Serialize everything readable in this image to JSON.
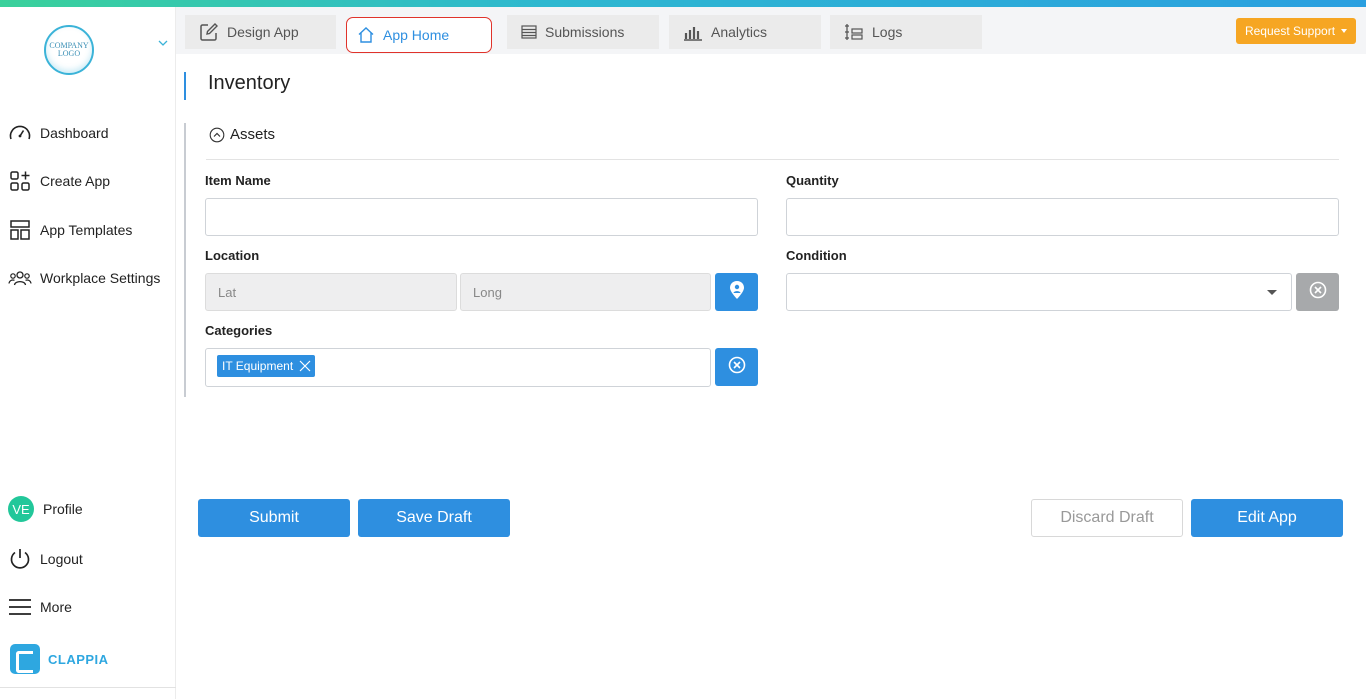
{
  "app": {
    "logo_text": "COMPANY LOGO"
  },
  "sidebar": {
    "items": [
      {
        "label": "Dashboard",
        "icon": "speedometer-icon"
      },
      {
        "label": "Create App",
        "icon": "grid-plus-icon"
      },
      {
        "label": "App Templates",
        "icon": "layout-template-icon"
      },
      {
        "label": "Workplace Settings",
        "icon": "users-icon"
      }
    ],
    "bottom_items": [
      {
        "label": "Profile",
        "icon": "avatar",
        "initials": "VE"
      },
      {
        "label": "Logout",
        "icon": "power-icon"
      },
      {
        "label": "More",
        "icon": "hamburger-icon"
      }
    ],
    "brand": "CLAPPIA"
  },
  "tabs": [
    {
      "label": "Design App",
      "icon": "edit-icon",
      "active": false
    },
    {
      "label": "App Home",
      "icon": "home-icon",
      "active": true
    },
    {
      "label": "Submissions",
      "icon": "list-icon",
      "active": false
    },
    {
      "label": "Analytics",
      "icon": "bar-chart-icon",
      "active": false
    },
    {
      "label": "Logs",
      "icon": "logs-icon",
      "active": false
    }
  ],
  "support_label": "Request Support",
  "page": {
    "title": "Inventory",
    "section_title": "Assets"
  },
  "form": {
    "item_name": {
      "label": "Item Name",
      "value": ""
    },
    "quantity": {
      "label": "Quantity",
      "value": ""
    },
    "location": {
      "label": "Location",
      "lat_placeholder": "Lat",
      "long_placeholder": "Long"
    },
    "condition": {
      "label": "Condition",
      "value": ""
    },
    "categories": {
      "label": "Categories",
      "chips": [
        "IT Equipment"
      ]
    }
  },
  "actions": {
    "submit": "Submit",
    "save_draft": "Save Draft",
    "discard_draft": "Discard Draft",
    "edit_app": "Edit App"
  },
  "colors": {
    "accent": "#2e8fe0",
    "support": "#f6a623",
    "active_tab_border": "#e0332b",
    "avatar": "#22c79a"
  }
}
